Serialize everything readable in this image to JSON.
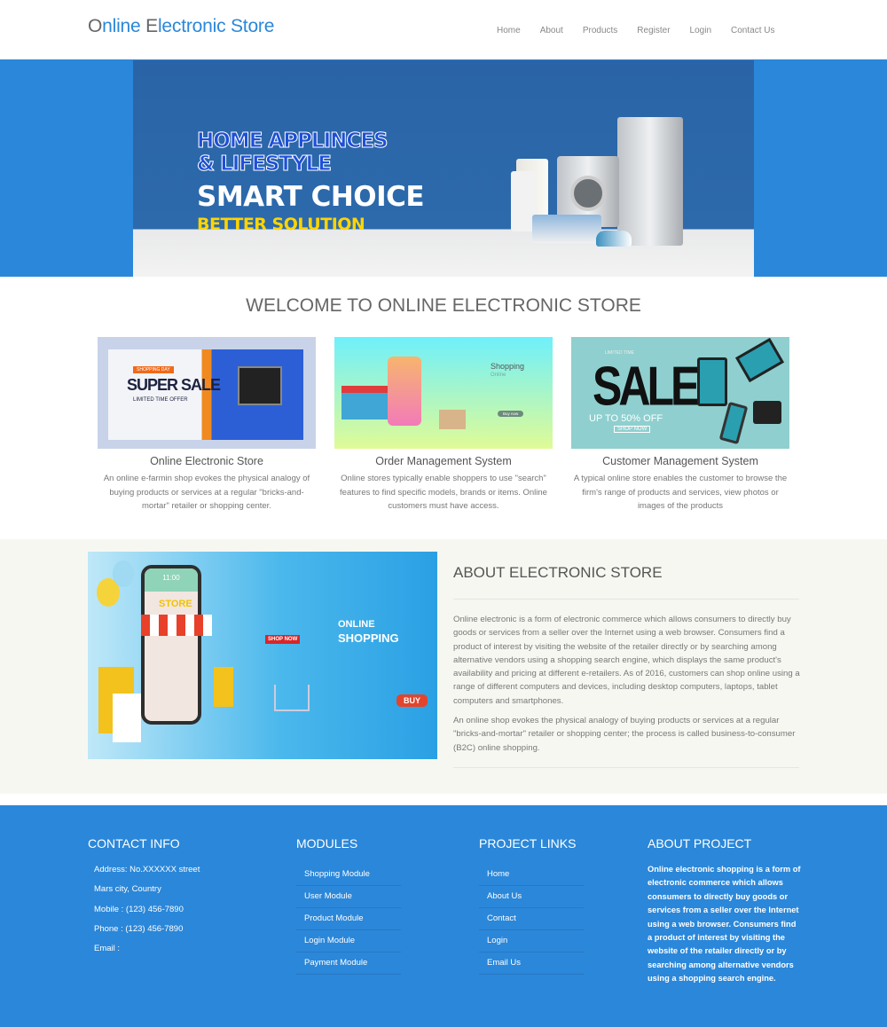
{
  "header": {
    "brand_parts": [
      {
        "text": "O",
        "gray": true
      },
      {
        "text": "nline ",
        "gray": false
      },
      {
        "text": "E",
        "gray": true
      },
      {
        "text": "lectronic Store",
        "gray": false
      }
    ],
    "nav": [
      "Home",
      "About",
      "Products",
      "Register",
      "Login",
      "Contact Us"
    ]
  },
  "banner": {
    "line1": "HOME APPLINCES",
    "line2": "& LIFESTYLE",
    "line3": "SMART CHOICE",
    "line4": "BETTER SOLUTION"
  },
  "welcome": {
    "title": "WELCOME TO ONLINE ELECTRONIC STORE",
    "cards": [
      {
        "title": "Online Electronic Store",
        "text": "An online e-farmin shop evokes the physical analogy of buying products or services at a regular \"bricks-and-mortar\" retailer or shopping center.",
        "image_text": [
          "SHOPPING DAY",
          "SUPER SALE",
          "LIMITED TIME OFFER"
        ]
      },
      {
        "title": "Order Management System",
        "text": "Online stores typically enable shoppers to use \"search\" features to find specific models, brands or items. Online customers must have access.",
        "image_text": [
          "Shopping",
          "Online",
          "STORE",
          "Buy now"
        ]
      },
      {
        "title": "Customer Management System",
        "text": "A typical online store enables the customer to browse the firm's range of products and services, view photos or images of the products",
        "image_text": [
          "LIMITED TIME",
          "SALE",
          "UP TO 50% OFF",
          "SHOP NOW"
        ]
      }
    ]
  },
  "about": {
    "title": "ABOUT ELECTRONIC STORE",
    "paragraphs": [
      "Online electronic is a form of electronic commerce which allows consumers to directly buy goods or services from a seller over the Internet using a web browser. Consumers find a product of interest by visiting the website of the retailer directly or by searching among alternative vendors using a shopping search engine, which displays the same product's availability and pricing at different e-retailers. As of 2016, customers can shop online using a range of different computers and devices, including desktop computers, laptops, tablet computers and smartphones.",
      "An online shop evokes the physical analogy of buying products or services at a regular \"bricks-and-mortar\" retailer or shopping center; the process is called business-to-consumer (B2C) online shopping."
    ],
    "image_text": [
      "ONLINE",
      "SHOPPING",
      "STORE",
      "BUY",
      "11:00",
      "SHOP NOW"
    ]
  },
  "footer": {
    "contact": {
      "title": "CONTACT INFO",
      "items": [
        "Address: No.XXXXXX street",
        "Mars city, Country",
        "Mobile : (123) 456-7890",
        "Phone : (123) 456-7890",
        "Email :"
      ]
    },
    "modules": {
      "title": "MODULES",
      "items": [
        "Shopping Module",
        "User Module",
        "Product Module",
        "Login Module",
        "Payment Module"
      ]
    },
    "links": {
      "title": "PROJECT LINKS",
      "items": [
        "Home",
        "About Us",
        "Contact",
        "Login",
        "Email Us"
      ]
    },
    "about": {
      "title": "ABOUT PROJECT",
      "text": "Online electronic shopping is a form of electronic commerce which allows consumers to directly buy goods or services from a seller over the Internet using a web browser. Consumers find a product of interest by visiting the website of the retailer directly or by searching among alternative vendors using a shopping search engine."
    }
  },
  "colors": {
    "primary": "#2b87d9",
    "about_bg": "#f7f7f2"
  }
}
